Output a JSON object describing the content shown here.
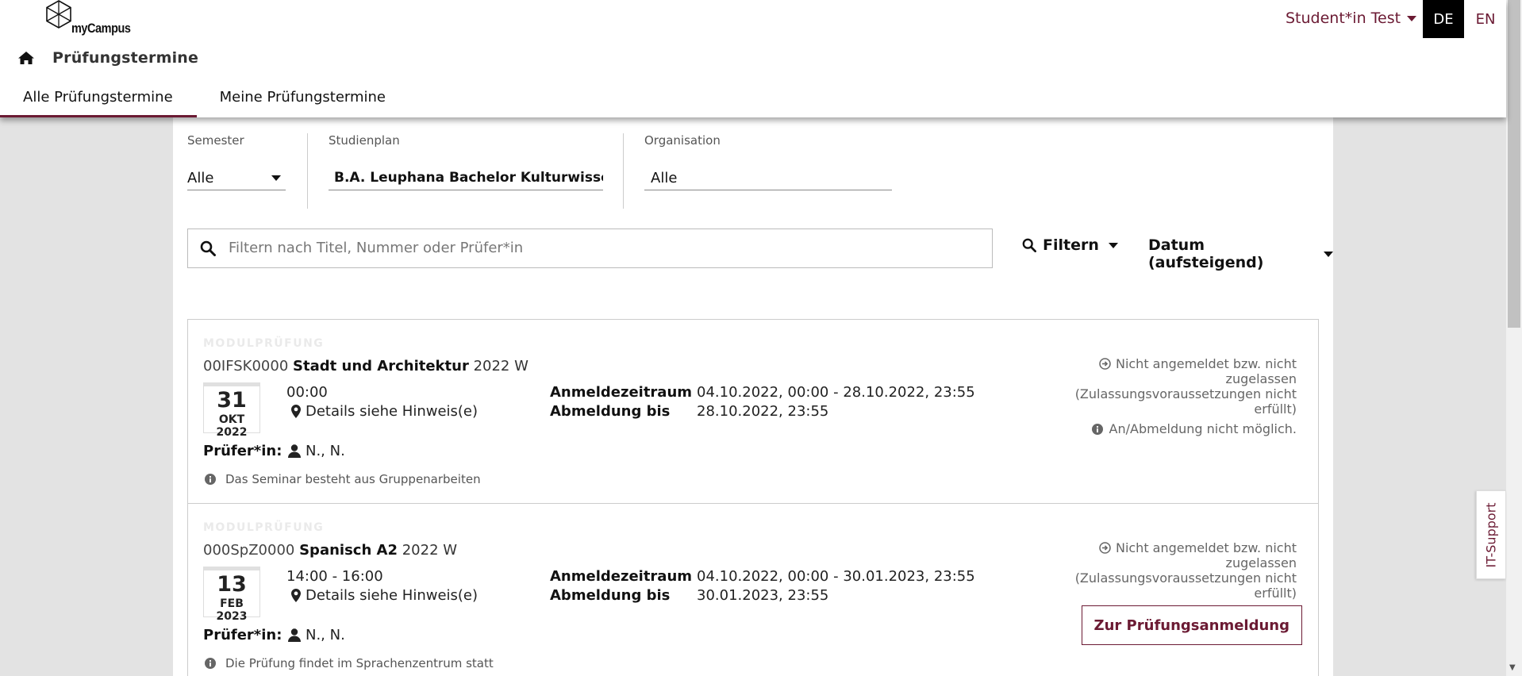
{
  "header": {
    "logo_text": "myCampus",
    "user": "Student*in Test",
    "lang_active": "DE",
    "lang_other": "EN",
    "page_title": "Prüfungstermine"
  },
  "tabs": [
    {
      "label": "Alle Prüfungstermine",
      "active": true
    },
    {
      "label": "Meine Prüfungstermine",
      "active": false
    }
  ],
  "filters": {
    "semester": {
      "label": "Semester",
      "value": "Alle"
    },
    "studienplan": {
      "label": "Studienplan",
      "value": "B.A. Leuphana Bachelor Kulturwissens ..."
    },
    "organisation": {
      "label": "Organisation",
      "value": "Alle"
    }
  },
  "search": {
    "placeholder": "Filtern nach Titel, Nummer oder Prüfer*in"
  },
  "toolbar": {
    "filter_label": "Filtern",
    "sort_label": "Datum (aufsteigend)"
  },
  "exams": [
    {
      "type": "MODULPRÜFUNG",
      "number": "00IFSK0000",
      "name": "Stadt und Architektur",
      "semester": "2022 W",
      "day": "31",
      "month_year": "OKT 2022",
      "time": "00:00",
      "location": "Details siehe Hinweis(e)",
      "reg_period_label": "Anmeldezeitraum",
      "reg_period": "04.10.2022, 00:00 - 28.10.2022, 23:55",
      "dereg_label": "Abmeldung bis",
      "dereg": "28.10.2022, 23:55",
      "examiner_label": "Prüfer*in:",
      "examiner": "N., N.",
      "note": "Das Seminar besteht aus Gruppenarbeiten",
      "status": "Nicht angemeldet bzw. nicht zugelassen (Zulassungsvoraussetzungen nicht erfüllt)",
      "status2": "An/Abmeldung nicht möglich."
    },
    {
      "type": "MODULPRÜFUNG",
      "number": "000SpZ0000",
      "name": "Spanisch A2",
      "semester": "2022 W",
      "day": "13",
      "month_year": "FEB 2023",
      "time": "14:00 - 16:00",
      "location": "Details siehe Hinweis(e)",
      "reg_period_label": "Anmeldezeitraum",
      "reg_period": "04.10.2022, 00:00 - 30.01.2023, 23:55",
      "dereg_label": "Abmeldung bis",
      "dereg": "30.01.2023, 23:55",
      "examiner_label": "Prüfer*in:",
      "examiner": "N., N.",
      "note": "Die Prüfung findet im Sprachenzentrum statt",
      "status": "Nicht angemeldet bzw. nicht zugelassen (Zulassungsvoraussetzungen nicht erfüllt)",
      "action": "Zur Prüfungsanmeldung"
    }
  ],
  "support": {
    "label": "IT-Support"
  },
  "colors": {
    "brand": "#6b1a33",
    "active_lang_bg": "#000000"
  }
}
